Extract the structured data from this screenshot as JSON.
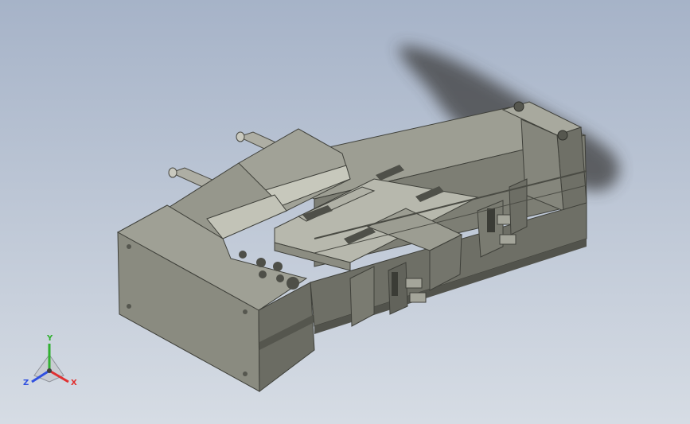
{
  "viewport": {
    "background_top": "#a6b3c8",
    "background_bottom": "#d6dce4",
    "model_color": "#8e8f84",
    "model_dark": "#5d5e55",
    "model_light": "#b4b5a9",
    "shadow_color": "#3c3c3c"
  },
  "triad": {
    "x_label": "X",
    "y_label": "Y",
    "z_label": "Z",
    "x_color": "#e03030",
    "y_color": "#30b030",
    "z_color": "#3050e0"
  }
}
